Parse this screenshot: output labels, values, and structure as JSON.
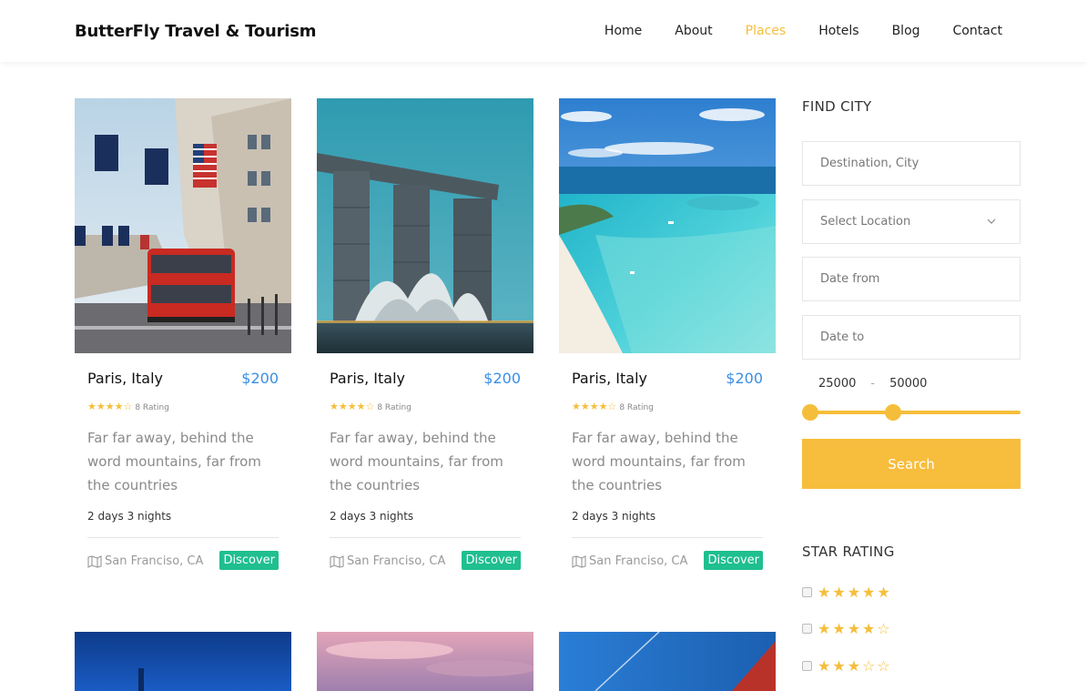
{
  "header": {
    "brand": "ButterFly Travel & Tourism",
    "nav": [
      "Home",
      "About",
      "Places",
      "Hotels",
      "Blog",
      "Contact"
    ],
    "active_nav": "Places"
  },
  "cards": [
    {
      "title": "Paris, Italy",
      "price": "$200",
      "stars": "★★★★☆",
      "rating_text": "8 Rating",
      "description": "Far far away, behind the word mountains, far from the countries",
      "duration": "2 days 3 nights",
      "location": "San Franciso, CA",
      "button": "Discover"
    },
    {
      "title": "Paris, Italy",
      "price": "$200",
      "stars": "★★★★☆",
      "rating_text": "8 Rating",
      "description": "Far far away, behind the word mountains, far from the countries",
      "duration": "2 days 3 nights",
      "location": "San Franciso, CA",
      "button": "Discover"
    },
    {
      "title": "Paris, Italy",
      "price": "$200",
      "stars": "★★★★☆",
      "rating_text": "8 Rating",
      "description": "Far far away, behind the word mountains, far from the countries",
      "duration": "2 days 3 nights",
      "location": "San Franciso, CA",
      "button": "Discover"
    }
  ],
  "sidebar": {
    "find_city": "FIND CITY",
    "destination_placeholder": "Destination, City",
    "location_select": "Select Location",
    "date_from_placeholder": "Date from",
    "date_to_placeholder": "Date to",
    "range_min": "25000",
    "range_sep": "-",
    "range_max": "50000",
    "search_button": "Search",
    "star_rating": "STAR RATING",
    "star_options": [
      "★★★★★",
      "★★★★☆",
      "★★★☆☆"
    ]
  },
  "colors": {
    "accent": "#f5be3a",
    "price": "#3a8ee6",
    "discover": "#1fbf8f"
  }
}
